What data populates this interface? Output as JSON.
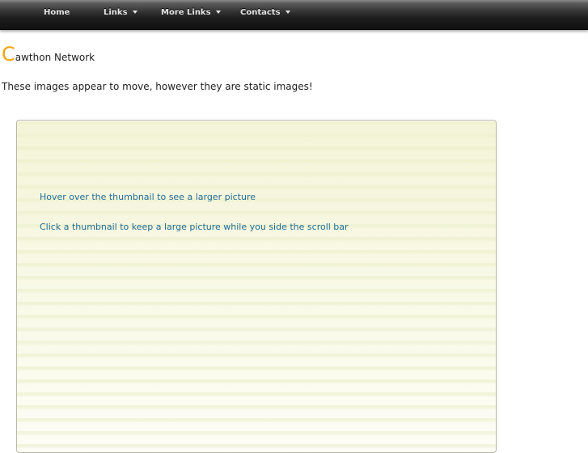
{
  "nav": {
    "items": [
      {
        "label": "Home",
        "has_dropdown": false
      },
      {
        "label": "Links",
        "has_dropdown": true
      },
      {
        "label": "More Links",
        "has_dropdown": true
      },
      {
        "label": "Contacts",
        "has_dropdown": true
      }
    ]
  },
  "brand": {
    "initial": "C",
    "rest": "awthon Network"
  },
  "intro": {
    "text": "These images appear to move, however they are static images!"
  },
  "panel": {
    "line1": "Hover over the thumbnail to see a larger picture",
    "line2": "Click a thumbnail to keep a large picture while you side the scroll bar"
  },
  "colors": {
    "accent": "#f5a20a",
    "link": "#1f6b96",
    "navbar": "#1e1e1e"
  }
}
